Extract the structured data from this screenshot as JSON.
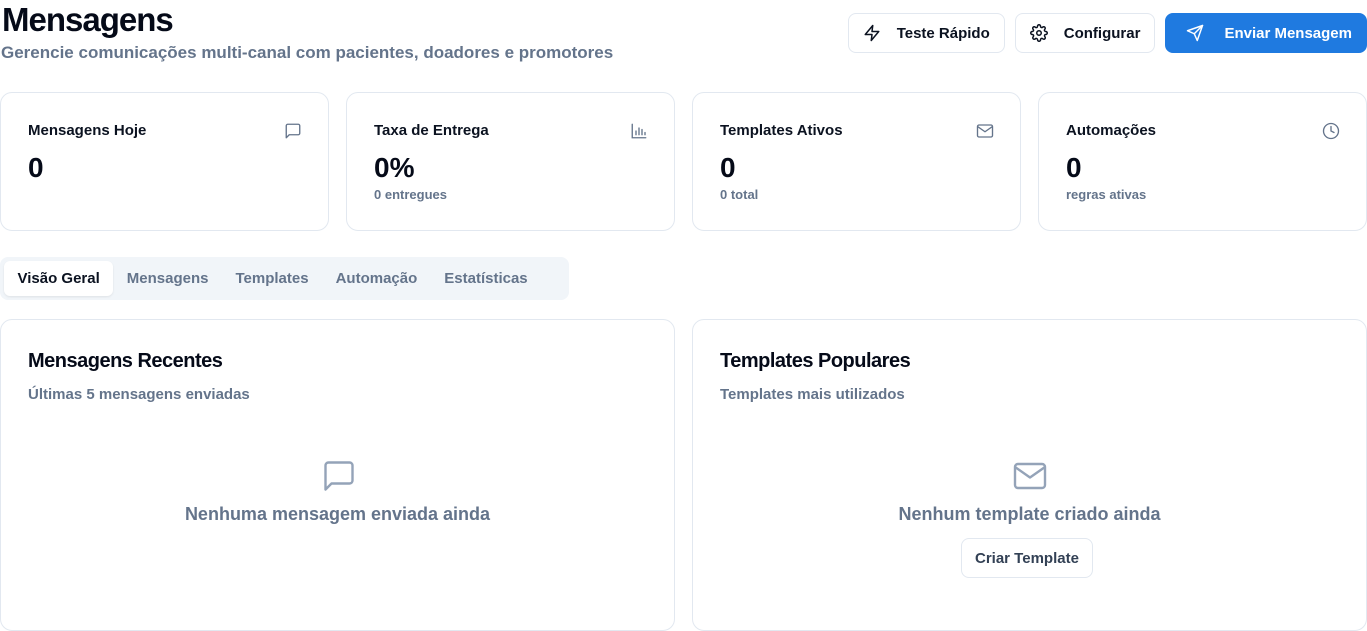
{
  "header": {
    "title": "Mensagens",
    "subtitle": "Gerencie comunicações multi-canal com pacientes, doadores e promotores",
    "actions": {
      "quick_test": "Teste Rápido",
      "configure": "Configurar",
      "send_message": "Enviar Mensagem"
    }
  },
  "stats": [
    {
      "title": "Mensagens Hoje",
      "value": "0",
      "sub": "",
      "icon": "message-square-icon"
    },
    {
      "title": "Taxa de Entrega",
      "value": "0%",
      "sub": "0 entregues",
      "icon": "bar-chart-icon"
    },
    {
      "title": "Templates Ativos",
      "value": "0",
      "sub": "0 total",
      "icon": "mail-icon"
    },
    {
      "title": "Automações",
      "value": "0",
      "sub": "regras ativas",
      "icon": "clock-icon"
    }
  ],
  "tabs": {
    "items": [
      "Visão Geral",
      "Mensagens",
      "Templates",
      "Automação",
      "Estatísticas"
    ],
    "active": "Visão Geral"
  },
  "recent": {
    "title": "Mensagens Recentes",
    "subtitle": "Últimas 5 mensagens enviadas",
    "empty_text": "Nenhuma mensagem enviada ainda"
  },
  "popular": {
    "title": "Templates Populares",
    "subtitle": "Templates mais utilizados",
    "empty_text": "Nenhum template criado ainda",
    "create_button": "Criar Template"
  },
  "colors": {
    "primary": "#1f7ae0",
    "muted": "#64748b",
    "border": "#e2e8f0"
  }
}
